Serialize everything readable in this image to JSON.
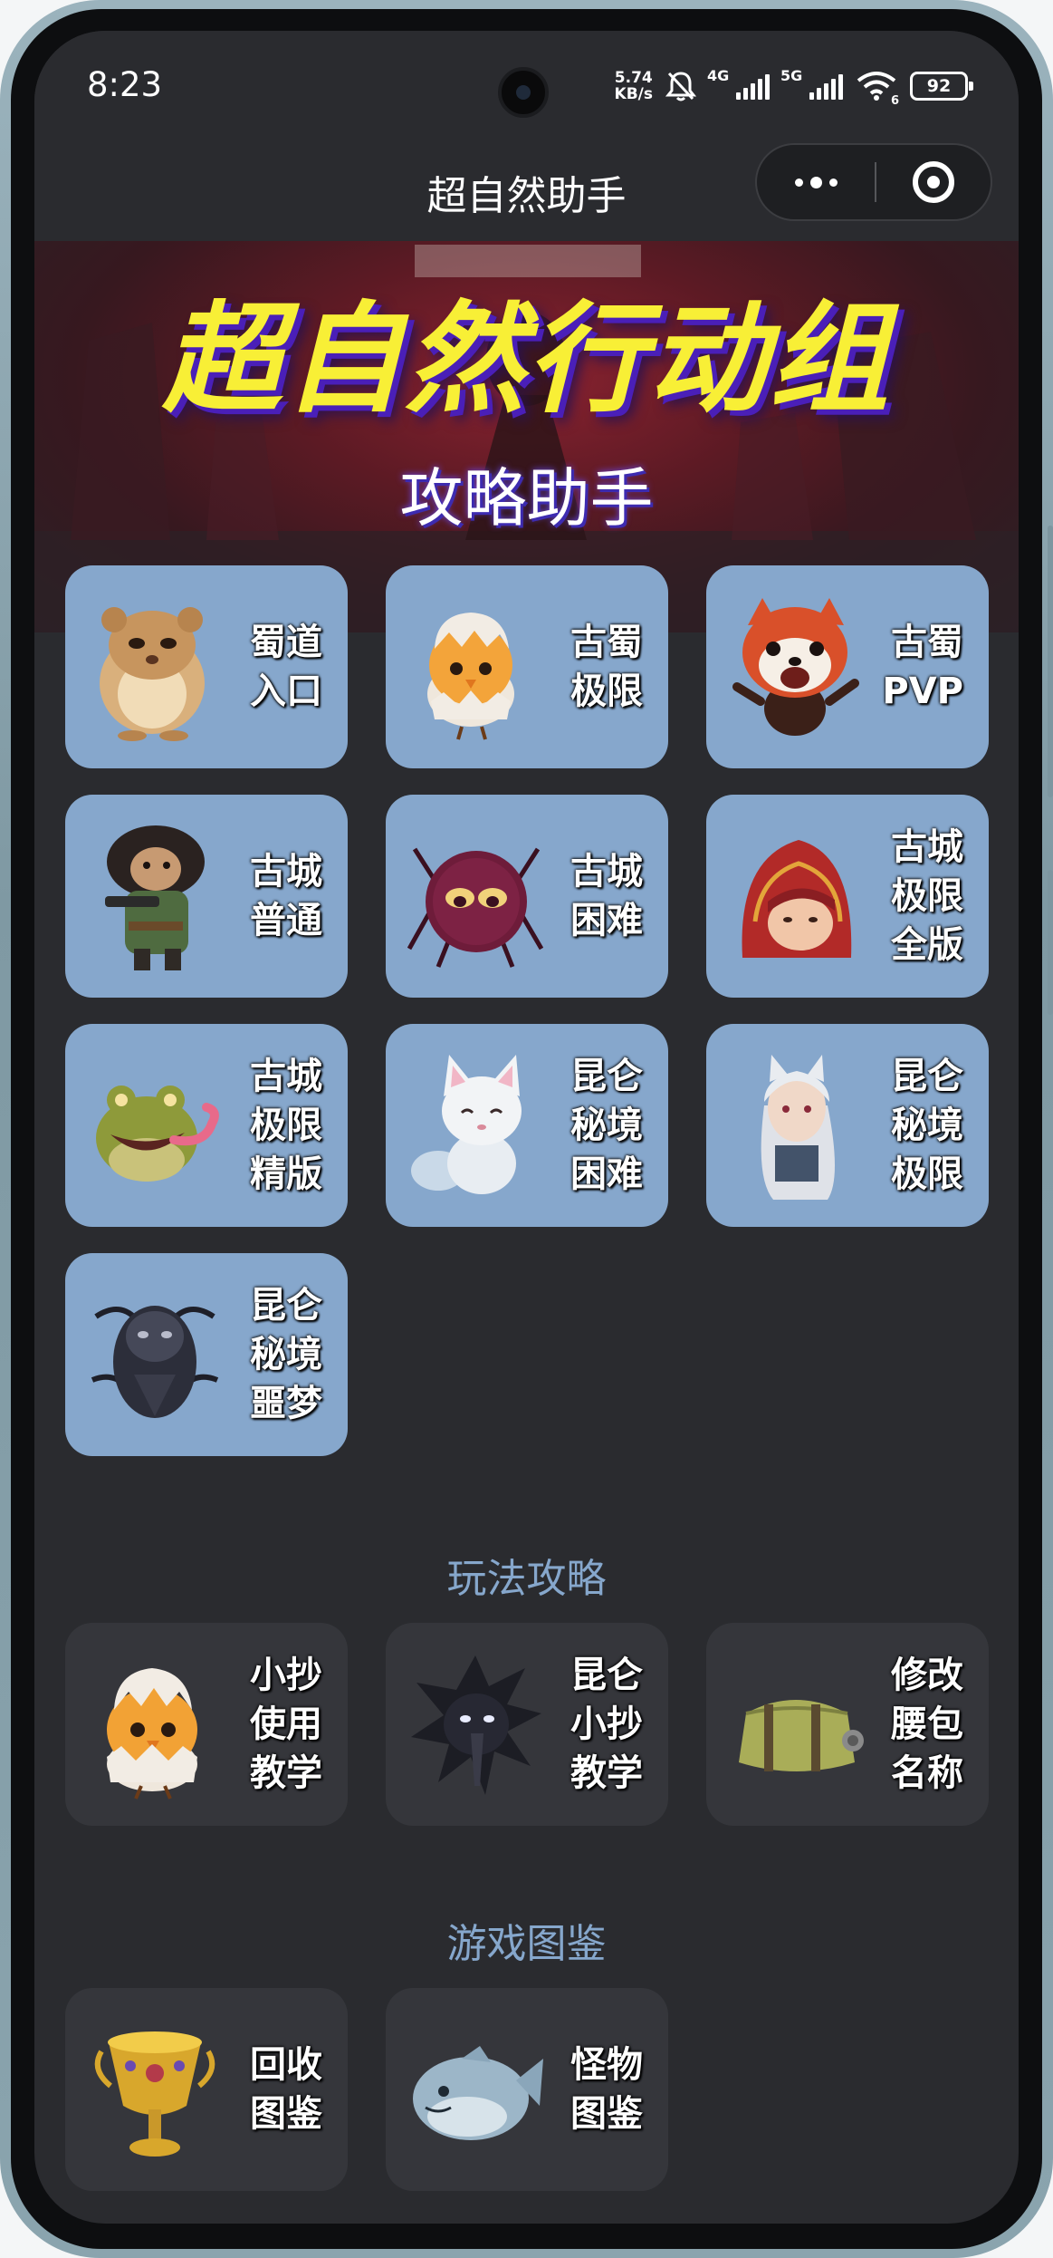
{
  "status_bar": {
    "time": "8:23",
    "speed_value": "5.74",
    "speed_unit": "KB/s",
    "network_1": "4G",
    "network_2": "5G",
    "wifi_label": "6",
    "battery": "92"
  },
  "nav": {
    "title": "超自然助手"
  },
  "banner": {
    "title": "超自然行动组",
    "subtitle": "攻略助手"
  },
  "stages": [
    {
      "label": "蜀道\n入口",
      "icon": "hamster-icon"
    },
    {
      "label": "古蜀\n极限",
      "icon": "chick-egg-icon"
    },
    {
      "label": "古蜀\nPVP",
      "icon": "red-panda-icon"
    },
    {
      "label": "古城\n普通",
      "icon": "hunter-icon"
    },
    {
      "label": "古城\n困难",
      "icon": "spider-icon"
    },
    {
      "label": "古城\n极限\n全版",
      "icon": "red-hood-icon"
    },
    {
      "label": "古城\n极限\n精版",
      "icon": "toad-icon"
    },
    {
      "label": "昆仑\n秘境\n困难",
      "icon": "fox-icon"
    },
    {
      "label": "昆仑\n秘境\n极限",
      "icon": "fox-girl-icon"
    },
    {
      "label": "昆仑\n秘境\n噩梦",
      "icon": "shadow-demon-icon"
    }
  ],
  "guides_section": {
    "title": "玩法攻略",
    "items": [
      {
        "label": "小抄\n使用\n教学",
        "icon": "chick-egg-icon"
      },
      {
        "label": "昆仑\n小抄\n教学",
        "icon": "black-crow-icon"
      },
      {
        "label": "修改\n腰包\n名称",
        "icon": "waist-bag-icon"
      }
    ]
  },
  "codex_section": {
    "title": "游戏图鉴",
    "items": [
      {
        "label": "回收\n图鉴",
        "icon": "golden-chalice-icon"
      },
      {
        "label": "怪物\n图鉴",
        "icon": "blue-fish-icon"
      }
    ]
  },
  "colors": {
    "screen_bg": "#2a2b2f",
    "card_blue": "#86a7cc",
    "card_dark": "#35363b",
    "section_title": "#86a7cc",
    "banner_title": "#f8ef36"
  }
}
